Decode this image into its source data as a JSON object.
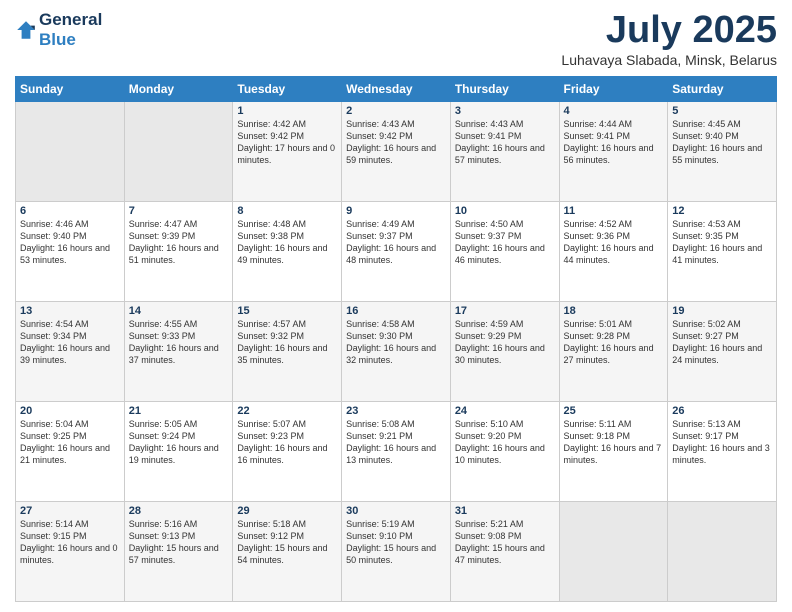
{
  "header": {
    "logo_line1": "General",
    "logo_line2": "Blue",
    "title": "July 2025",
    "subtitle": "Luhavaya Slabada, Minsk, Belarus"
  },
  "days_of_week": [
    "Sunday",
    "Monday",
    "Tuesday",
    "Wednesday",
    "Thursday",
    "Friday",
    "Saturday"
  ],
  "weeks": [
    [
      {
        "day": "",
        "sunrise": "",
        "sunset": "",
        "daylight": ""
      },
      {
        "day": "",
        "sunrise": "",
        "sunset": "",
        "daylight": ""
      },
      {
        "day": "1",
        "sunrise": "Sunrise: 4:42 AM",
        "sunset": "Sunset: 9:42 PM",
        "daylight": "Daylight: 17 hours and 0 minutes."
      },
      {
        "day": "2",
        "sunrise": "Sunrise: 4:43 AM",
        "sunset": "Sunset: 9:42 PM",
        "daylight": "Daylight: 16 hours and 59 minutes."
      },
      {
        "day": "3",
        "sunrise": "Sunrise: 4:43 AM",
        "sunset": "Sunset: 9:41 PM",
        "daylight": "Daylight: 16 hours and 57 minutes."
      },
      {
        "day": "4",
        "sunrise": "Sunrise: 4:44 AM",
        "sunset": "Sunset: 9:41 PM",
        "daylight": "Daylight: 16 hours and 56 minutes."
      },
      {
        "day": "5",
        "sunrise": "Sunrise: 4:45 AM",
        "sunset": "Sunset: 9:40 PM",
        "daylight": "Daylight: 16 hours and 55 minutes."
      }
    ],
    [
      {
        "day": "6",
        "sunrise": "Sunrise: 4:46 AM",
        "sunset": "Sunset: 9:40 PM",
        "daylight": "Daylight: 16 hours and 53 minutes."
      },
      {
        "day": "7",
        "sunrise": "Sunrise: 4:47 AM",
        "sunset": "Sunset: 9:39 PM",
        "daylight": "Daylight: 16 hours and 51 minutes."
      },
      {
        "day": "8",
        "sunrise": "Sunrise: 4:48 AM",
        "sunset": "Sunset: 9:38 PM",
        "daylight": "Daylight: 16 hours and 49 minutes."
      },
      {
        "day": "9",
        "sunrise": "Sunrise: 4:49 AM",
        "sunset": "Sunset: 9:37 PM",
        "daylight": "Daylight: 16 hours and 48 minutes."
      },
      {
        "day": "10",
        "sunrise": "Sunrise: 4:50 AM",
        "sunset": "Sunset: 9:37 PM",
        "daylight": "Daylight: 16 hours and 46 minutes."
      },
      {
        "day": "11",
        "sunrise": "Sunrise: 4:52 AM",
        "sunset": "Sunset: 9:36 PM",
        "daylight": "Daylight: 16 hours and 44 minutes."
      },
      {
        "day": "12",
        "sunrise": "Sunrise: 4:53 AM",
        "sunset": "Sunset: 9:35 PM",
        "daylight": "Daylight: 16 hours and 41 minutes."
      }
    ],
    [
      {
        "day": "13",
        "sunrise": "Sunrise: 4:54 AM",
        "sunset": "Sunset: 9:34 PM",
        "daylight": "Daylight: 16 hours and 39 minutes."
      },
      {
        "day": "14",
        "sunrise": "Sunrise: 4:55 AM",
        "sunset": "Sunset: 9:33 PM",
        "daylight": "Daylight: 16 hours and 37 minutes."
      },
      {
        "day": "15",
        "sunrise": "Sunrise: 4:57 AM",
        "sunset": "Sunset: 9:32 PM",
        "daylight": "Daylight: 16 hours and 35 minutes."
      },
      {
        "day": "16",
        "sunrise": "Sunrise: 4:58 AM",
        "sunset": "Sunset: 9:30 PM",
        "daylight": "Daylight: 16 hours and 32 minutes."
      },
      {
        "day": "17",
        "sunrise": "Sunrise: 4:59 AM",
        "sunset": "Sunset: 9:29 PM",
        "daylight": "Daylight: 16 hours and 30 minutes."
      },
      {
        "day": "18",
        "sunrise": "Sunrise: 5:01 AM",
        "sunset": "Sunset: 9:28 PM",
        "daylight": "Daylight: 16 hours and 27 minutes."
      },
      {
        "day": "19",
        "sunrise": "Sunrise: 5:02 AM",
        "sunset": "Sunset: 9:27 PM",
        "daylight": "Daylight: 16 hours and 24 minutes."
      }
    ],
    [
      {
        "day": "20",
        "sunrise": "Sunrise: 5:04 AM",
        "sunset": "Sunset: 9:25 PM",
        "daylight": "Daylight: 16 hours and 21 minutes."
      },
      {
        "day": "21",
        "sunrise": "Sunrise: 5:05 AM",
        "sunset": "Sunset: 9:24 PM",
        "daylight": "Daylight: 16 hours and 19 minutes."
      },
      {
        "day": "22",
        "sunrise": "Sunrise: 5:07 AM",
        "sunset": "Sunset: 9:23 PM",
        "daylight": "Daylight: 16 hours and 16 minutes."
      },
      {
        "day": "23",
        "sunrise": "Sunrise: 5:08 AM",
        "sunset": "Sunset: 9:21 PM",
        "daylight": "Daylight: 16 hours and 13 minutes."
      },
      {
        "day": "24",
        "sunrise": "Sunrise: 5:10 AM",
        "sunset": "Sunset: 9:20 PM",
        "daylight": "Daylight: 16 hours and 10 minutes."
      },
      {
        "day": "25",
        "sunrise": "Sunrise: 5:11 AM",
        "sunset": "Sunset: 9:18 PM",
        "daylight": "Daylight: 16 hours and 7 minutes."
      },
      {
        "day": "26",
        "sunrise": "Sunrise: 5:13 AM",
        "sunset": "Sunset: 9:17 PM",
        "daylight": "Daylight: 16 hours and 3 minutes."
      }
    ],
    [
      {
        "day": "27",
        "sunrise": "Sunrise: 5:14 AM",
        "sunset": "Sunset: 9:15 PM",
        "daylight": "Daylight: 16 hours and 0 minutes."
      },
      {
        "day": "28",
        "sunrise": "Sunrise: 5:16 AM",
        "sunset": "Sunset: 9:13 PM",
        "daylight": "Daylight: 15 hours and 57 minutes."
      },
      {
        "day": "29",
        "sunrise": "Sunrise: 5:18 AM",
        "sunset": "Sunset: 9:12 PM",
        "daylight": "Daylight: 15 hours and 54 minutes."
      },
      {
        "day": "30",
        "sunrise": "Sunrise: 5:19 AM",
        "sunset": "Sunset: 9:10 PM",
        "daylight": "Daylight: 15 hours and 50 minutes."
      },
      {
        "day": "31",
        "sunrise": "Sunrise: 5:21 AM",
        "sunset": "Sunset: 9:08 PM",
        "daylight": "Daylight: 15 hours and 47 minutes."
      },
      {
        "day": "",
        "sunrise": "",
        "sunset": "",
        "daylight": ""
      },
      {
        "day": "",
        "sunrise": "",
        "sunset": "",
        "daylight": ""
      }
    ]
  ]
}
